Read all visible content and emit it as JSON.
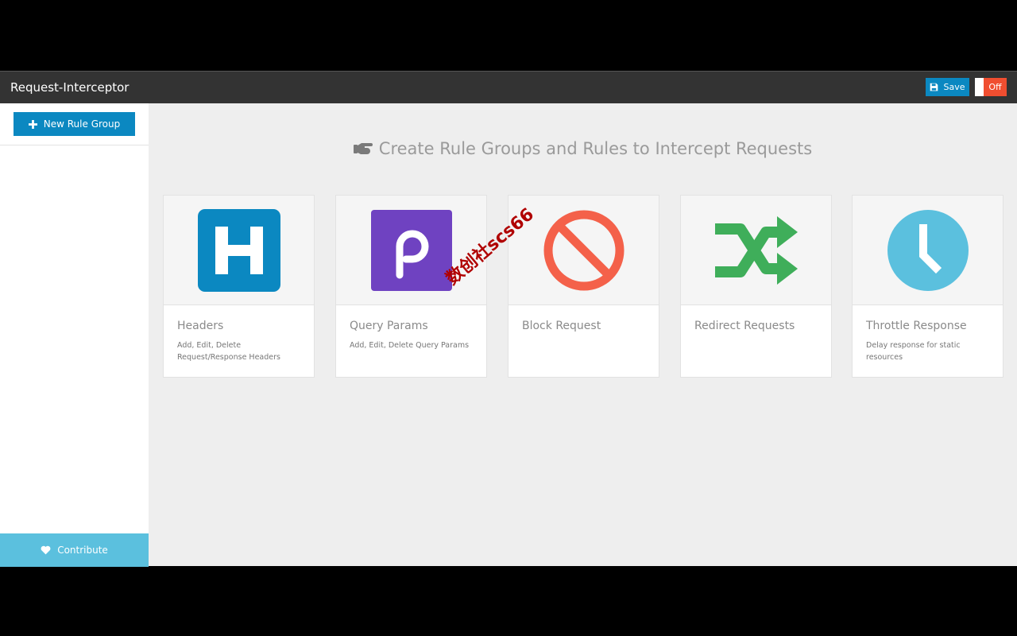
{
  "app": {
    "title": "Request-Interceptor"
  },
  "toolbar": {
    "save_label": "Save",
    "toggle_label": "Off"
  },
  "sidebar": {
    "new_group_label": "New Rule Group",
    "contribute_label": "Contribute"
  },
  "main": {
    "title": "Create Rule Groups and Rules to Intercept Requests",
    "cards": [
      {
        "title": "Headers",
        "description": "Add, Edit, Delete Request/Response Headers",
        "icon": "headers-icon"
      },
      {
        "title": "Query Params",
        "description": "Add, Edit, Delete Query Params",
        "icon": "query-params-icon"
      },
      {
        "title": "Block Request",
        "description": "",
        "icon": "block-icon"
      },
      {
        "title": "Redirect Requests",
        "description": "",
        "icon": "shuffle-icon"
      },
      {
        "title": "Throttle Response",
        "description": "Delay response for static resources",
        "icon": "clock-icon"
      }
    ]
  },
  "watermark": "数创社scs66",
  "colors": {
    "topbar": "#333333",
    "primary": "#0b88c1",
    "toggle_off": "#f04e30",
    "contribute": "#5bc0de",
    "purple": "#6f42c1",
    "block_red": "#f4614a",
    "redirect_green": "#3fae5a"
  }
}
